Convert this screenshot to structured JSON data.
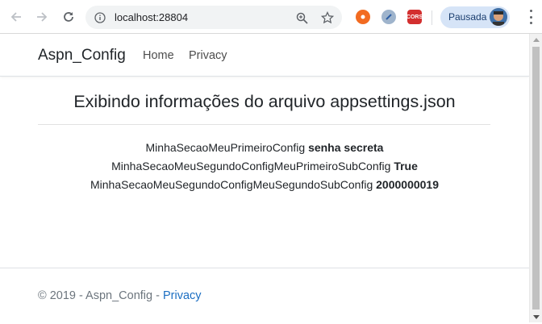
{
  "browser": {
    "url": "localhost:28804",
    "profile_label": "Pausada",
    "extension_cors_label": "CORS"
  },
  "site": {
    "brand": "Aspn_Config",
    "nav": [
      "Home",
      "Privacy"
    ]
  },
  "main": {
    "heading": "Exibindo informações do arquivo appsettings.json",
    "configs": [
      {
        "key": "MinhaSecaoMeuPrimeiroConfig",
        "value": "senha secreta"
      },
      {
        "key": "MinhaSecaoMeuSegundoConfigMeuPrimeiroSubConfig",
        "value": "True"
      },
      {
        "key": "MinhaSecaoMeuSegundoConfigMeuSegundoSubConfig",
        "value": "2000000019"
      }
    ]
  },
  "footer": {
    "text": "© 2019 - Aspn_Config - ",
    "link": "Privacy"
  },
  "colors": {
    "link": "#1b6ec2",
    "profile_bg": "#d6e4f7"
  }
}
